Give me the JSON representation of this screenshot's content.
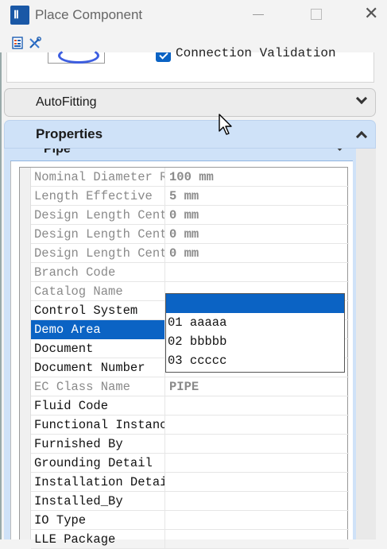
{
  "window": {
    "title": "Place Component",
    "app_icon_glyph": "Ⅱ",
    "close_glyph": "✕"
  },
  "toolbar": {
    "icons": [
      "properties-sheet-icon",
      "tools-icon"
    ]
  },
  "top_panel": {
    "connection_validation_label": "Connection Validation",
    "connection_validation_checked": true
  },
  "sections": {
    "autofitting": {
      "label": "AutoFitting",
      "expanded": false
    },
    "properties": {
      "label": "Properties",
      "expanded": true
    }
  },
  "group": {
    "label": "Pipe"
  },
  "properties": [
    {
      "name": "Nominal Diameter Ru",
      "value": "100 mm",
      "readonly": true
    },
    {
      "name": "Length Effective",
      "value": "5 mm",
      "readonly": true
    },
    {
      "name": "Design Length Cente",
      "value": "0 mm",
      "readonly": true
    },
    {
      "name": "Design Length Cente",
      "value": "0 mm",
      "readonly": true
    },
    {
      "name": "Design Length Cente",
      "value": "0 mm",
      "readonly": true
    },
    {
      "name": "Branch Code",
      "value": "",
      "readonly": true
    },
    {
      "name": "Catalog Name",
      "value": "",
      "readonly": true
    },
    {
      "name": "Control System",
      "value": "",
      "readonly": false
    },
    {
      "name": "Demo Area",
      "value": "",
      "readonly": false,
      "selected": true
    },
    {
      "name": "Document",
      "value": "",
      "readonly": false
    },
    {
      "name": "Document Number",
      "value": "",
      "readonly": false
    },
    {
      "name": "EC Class Name",
      "value": "PIPE",
      "readonly": true
    },
    {
      "name": "Fluid Code",
      "value": "",
      "readonly": false
    },
    {
      "name": "Functional Instance",
      "value": "",
      "readonly": false
    },
    {
      "name": "Furnished By",
      "value": "",
      "readonly": false
    },
    {
      "name": "Grounding Detail",
      "value": "",
      "readonly": false
    },
    {
      "name": "Installation Detail",
      "value": "",
      "readonly": false
    },
    {
      "name": "Installed_By",
      "value": "",
      "readonly": false
    },
    {
      "name": "IO Type",
      "value": "",
      "readonly": false
    },
    {
      "name": "LLE Package",
      "value": "",
      "readonly": false
    }
  ],
  "dropdown": {
    "options": [
      "",
      "01 aaaaa",
      "02 bbbbb",
      "03 ccccc"
    ],
    "highlighted_index": 0
  },
  "colors": {
    "accent": "#0b63c4",
    "section_active": "#cfe2f8",
    "readonly_text": "#8a8a8a"
  }
}
